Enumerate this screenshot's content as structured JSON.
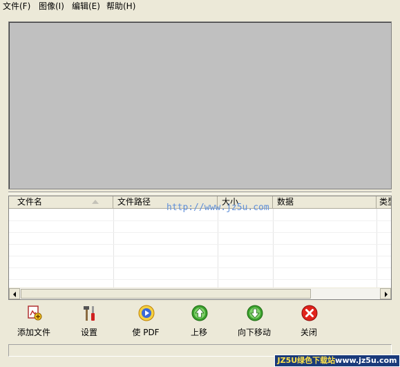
{
  "menu": [
    {
      "label": "文件(F)"
    },
    {
      "label": "图像(I)"
    },
    {
      "label": "编辑(E)"
    },
    {
      "label": "帮助(H)"
    }
  ],
  "grid": {
    "columns": [
      "文件名",
      "文件路径",
      "大小",
      "数据",
      "类型"
    ],
    "watermark": "http://www.jz5u.com"
  },
  "toolbar": {
    "add_file": "添加文件",
    "settings": "设置",
    "to_pdf": "使 PDF",
    "move_up": "上移",
    "move_down": "向下移动",
    "close": "关闭"
  },
  "footer": {
    "brand_prefix": "JZ5U绿色下载站",
    "brand_url": "www.jz5u.com"
  },
  "colors": {
    "window_bg": "#ece9d8",
    "preview_bg": "#c0c0c0",
    "close_red": "#e0241c",
    "nav_green": "#3aa02c",
    "watermark_blue": "#5f8fd8",
    "brand_bg": "#1a3a7a"
  },
  "icons": {
    "add_file": "add-image-icon",
    "settings": "tools-icon",
    "to_pdf": "pdf-convert-icon",
    "move_up": "arrow-up-icon",
    "move_down": "arrow-down-icon",
    "close": "close-icon"
  }
}
